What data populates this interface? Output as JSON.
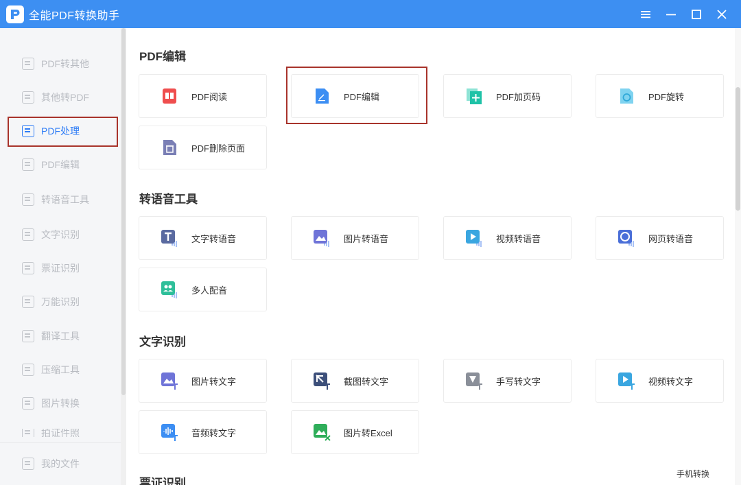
{
  "app": {
    "title": "全能PDF转换助手"
  },
  "sidebar": {
    "items": [
      {
        "label": "PDF转其他"
      },
      {
        "label": "其他转PDF"
      },
      {
        "label": "PDF处理"
      },
      {
        "label": "PDF编辑"
      },
      {
        "label": "转语音工具"
      },
      {
        "label": "文字识别"
      },
      {
        "label": "票证识别"
      },
      {
        "label": "万能识别"
      },
      {
        "label": "翻译工具"
      },
      {
        "label": "压缩工具"
      },
      {
        "label": "图片转换"
      },
      {
        "label": "拍证件照"
      }
    ],
    "my_files": "我的文件"
  },
  "sections": [
    {
      "title": "PDF编辑",
      "cards": [
        {
          "label": "PDF阅读",
          "icon": "pdf-read-icon",
          "color": "#ef4e4e"
        },
        {
          "label": "PDF编辑",
          "icon": "pdf-edit-icon",
          "color": "#3c8ef3"
        },
        {
          "label": "PDF加页码",
          "icon": "pdf-page-number-icon",
          "color": "#1fc2a7"
        },
        {
          "label": "PDF旋转",
          "icon": "pdf-rotate-icon",
          "color": "#44bde8"
        },
        {
          "label": "PDF删除页面",
          "icon": "pdf-delete-page-icon",
          "color": "#7a7fb5"
        }
      ]
    },
    {
      "title": "转语音工具",
      "cards": [
        {
          "label": "文字转语音",
          "icon": "text-to-speech-icon",
          "color": "#5a6aa0"
        },
        {
          "label": "图片转语音",
          "icon": "image-to-speech-icon",
          "color": "#6f74d8"
        },
        {
          "label": "视频转语音",
          "icon": "video-to-speech-icon",
          "color": "#3aa6e0"
        },
        {
          "label": "网页转语音",
          "icon": "web-to-speech-icon",
          "color": "#4a6fd8"
        },
        {
          "label": "多人配音",
          "icon": "multi-voice-icon",
          "color": "#2fbf9a"
        }
      ]
    },
    {
      "title": "文字识别",
      "cards": [
        {
          "label": "图片转文字",
          "icon": "image-to-text-icon",
          "color": "#6f74d8"
        },
        {
          "label": "截图转文字",
          "icon": "screenshot-to-text-icon",
          "color": "#3c4f7a"
        },
        {
          "label": "手写转文字",
          "icon": "handwriting-to-text-icon",
          "color": "#8a8f99"
        },
        {
          "label": "视频转文字",
          "icon": "video-to-text-icon",
          "color": "#3aa6e0"
        },
        {
          "label": "音频转文字",
          "icon": "audio-to-text-icon",
          "color": "#3c8ef3"
        },
        {
          "label": "图片转Excel",
          "icon": "image-to-excel-icon",
          "color": "#2fae5a"
        }
      ]
    }
  ],
  "cut_section_title": "票证识别",
  "footer": {
    "phone_convert": "手机转换"
  },
  "colors": {
    "titlebar": "#3d8ff2",
    "active": "#2e7cf6",
    "highlight": "#a8332b"
  }
}
